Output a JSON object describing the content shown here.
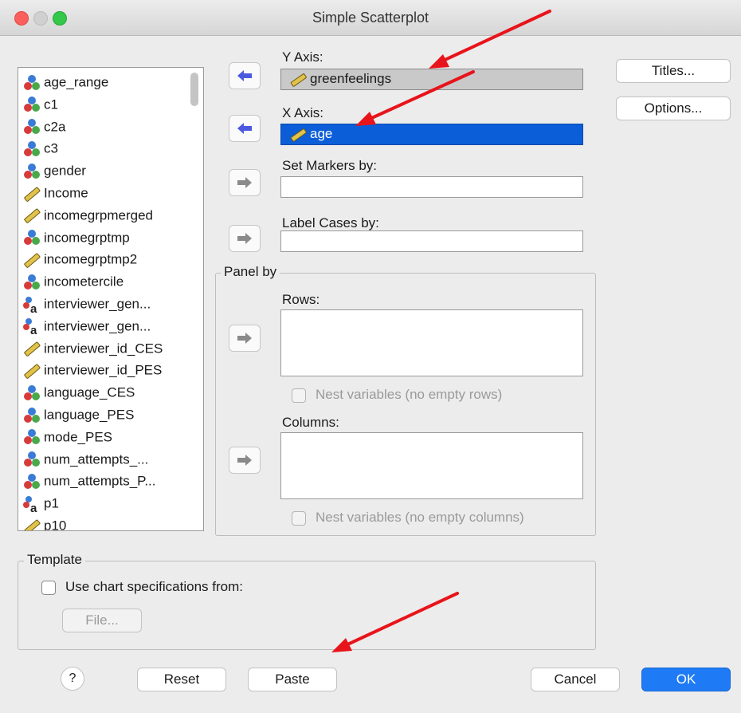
{
  "window": {
    "title": "Simple Scatterplot"
  },
  "variables": [
    {
      "label": "age_range",
      "icon": "nominal-icon"
    },
    {
      "label": "c1",
      "icon": "nominal-icon"
    },
    {
      "label": "c2a",
      "icon": "nominal-icon"
    },
    {
      "label": "c3",
      "icon": "nominal-icon"
    },
    {
      "label": "gender",
      "icon": "nominal-icon"
    },
    {
      "label": "Income",
      "icon": "scale-ruler-icon"
    },
    {
      "label": "incomegrpmerged",
      "icon": "scale-ruler-icon"
    },
    {
      "label": "incomegrptmp",
      "icon": "nominal-icon"
    },
    {
      "label": "incomegrptmp2",
      "icon": "scale-ruler-icon"
    },
    {
      "label": "incometercile",
      "icon": "nominal-icon"
    },
    {
      "label": "interviewer_gen...",
      "icon": "string-nominal-icon"
    },
    {
      "label": "interviewer_gen...",
      "icon": "string-nominal-icon"
    },
    {
      "label": "interviewer_id_CES",
      "icon": "scale-ruler-icon"
    },
    {
      "label": "interviewer_id_PES",
      "icon": "scale-ruler-icon"
    },
    {
      "label": "language_CES",
      "icon": "nominal-icon"
    },
    {
      "label": "language_PES",
      "icon": "nominal-icon"
    },
    {
      "label": "mode_PES",
      "icon": "nominal-icon"
    },
    {
      "label": "num_attempts_...",
      "icon": "nominal-icon"
    },
    {
      "label": "num_attempts_P...",
      "icon": "nominal-icon"
    },
    {
      "label": "p1",
      "icon": "string-nominal-icon"
    },
    {
      "label": "p10",
      "icon": "scale-ruler-icon"
    }
  ],
  "fields": {
    "y_axis_label": "Y Axis:",
    "y_axis_value": "greenfeelings",
    "x_axis_label": "X Axis:",
    "x_axis_value": "age",
    "set_markers_label": "Set Markers by:",
    "label_cases_label": "Label Cases by:"
  },
  "panel": {
    "legend": "Panel by",
    "rows_label": "Rows:",
    "rows_nest": "Nest variables (no empty rows)",
    "columns_label": "Columns:",
    "columns_nest": "Nest variables (no empty columns)"
  },
  "side_buttons": {
    "titles": "Titles...",
    "options": "Options..."
  },
  "template": {
    "legend": "Template",
    "use_spec": "Use chart specifications from:",
    "file_button": "File..."
  },
  "footer": {
    "help": "?",
    "reset": "Reset",
    "paste": "Paste",
    "cancel": "Cancel",
    "ok": "OK"
  },
  "colors": {
    "selected_field": "#0b5ed7",
    "ok_button": "#1f7bf5",
    "annotation_arrow": "#e8141b",
    "active_arrow": "#4a59e0"
  }
}
